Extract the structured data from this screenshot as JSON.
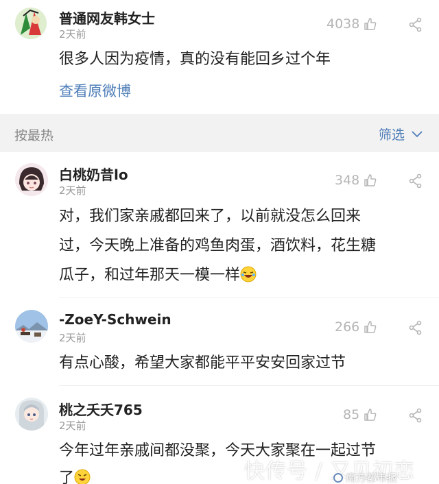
{
  "post": {
    "user": "普通网友韩女士",
    "time": "2天前",
    "likes": "4038",
    "text": "很多人因为疫情，真的没有能回乡过个年",
    "view_original": "查看原微博"
  },
  "sort_bar": {
    "label": "按最热",
    "filter": "筛选"
  },
  "comments": [
    {
      "user": "白桃奶昔lo",
      "time": "2天前",
      "likes": "348",
      "lines": [
        "对，我们家亲戚都回来了，以前就没怎么回来",
        "过，今天晚上准备的鸡鱼肉蛋，酒饮料，花生糖",
        "瓜子，和过年那天一模一样"
      ]
    },
    {
      "user": "-ZoeY-Schwein",
      "time": "2天前",
      "likes": "266",
      "lines": [
        "有点心酸，希望大家都能平平安安回家过节"
      ]
    },
    {
      "user": "桃之夭夭765",
      "time": "2天前",
      "likes": "85",
      "lines": [
        "今年过年亲戚间都没聚，今天大家聚在一起过节",
        "了"
      ]
    }
  ],
  "watermark": {
    "text": "快传号 / 又见初恋",
    "badge": "南方都市报"
  },
  "colors": {
    "link": "#4d7db8",
    "sort_bg": "#f2f2f2",
    "muted": "#999999"
  }
}
